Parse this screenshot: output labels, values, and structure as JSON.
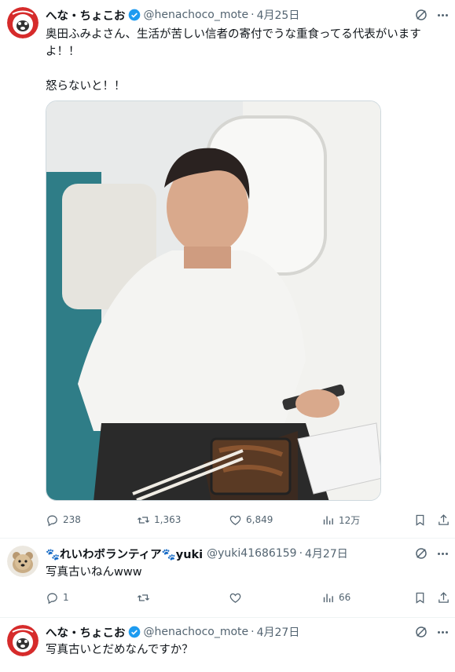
{
  "tweets": [
    {
      "name": "へな・ちょこお",
      "handle": "@henachoco_mote",
      "dot": "·",
      "date": "4月25日",
      "text": "奥田ふみよさん、生活が苦しい信者の寄付でうな重食ってる代表がいますよ！！\n\n怒らないと！！",
      "stats": {
        "reply": "238",
        "retweet": "1,363",
        "like": "6,849",
        "views": "12万"
      }
    },
    {
      "name": "🐾れいわボランティア🐾yuki",
      "handle": "@yuki41686159",
      "dot": "·",
      "date": "4月27日",
      "text": "写真古いねんwww",
      "stats": {
        "reply": "1",
        "retweet": "",
        "like": "",
        "views": "66"
      }
    },
    {
      "name": "へな・ちょこお",
      "handle": "@henachoco_mote",
      "dot": "·",
      "date": "4月27日",
      "text": "写真古いとだめなんですか？"
    }
  ],
  "colors": {
    "text": "#0f1419",
    "secondary": "#536471",
    "verified": "#1d9bf0",
    "divider": "#eff3f4"
  }
}
